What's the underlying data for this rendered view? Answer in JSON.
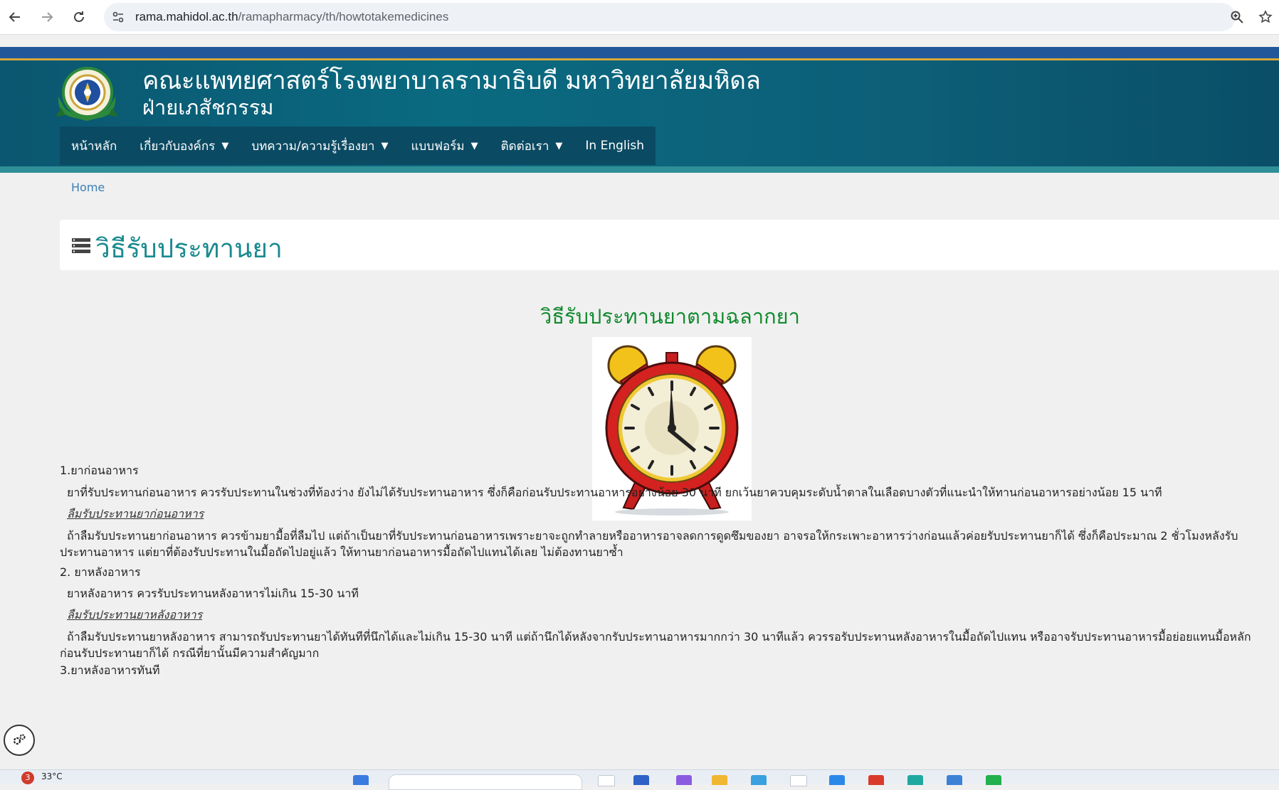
{
  "browser": {
    "url_host": "rama.mahidol.ac.th",
    "url_path": "/ramapharmacy/th/howtotakemedicines",
    "icons": [
      "back-arrow-icon",
      "forward-arrow-icon",
      "reload-icon",
      "site-info-icon",
      "zoom-icon",
      "bookmark-star-icon"
    ]
  },
  "header": {
    "title": "คณะแพทยศาสตร์โรงพยาบาลรามาธิบดี มหาวิทยาลัยมหิดล",
    "subtitle": "ฝ่ายเภสัชกรรม",
    "colors": {
      "primary": "#0b5670",
      "accent_gold": "#d8a83a",
      "top_strip": "#22589a",
      "teal_bar": "#2f8f98"
    }
  },
  "menu": {
    "items": [
      {
        "label": "หน้าหลัก",
        "has_dropdown": false
      },
      {
        "label": "เกี่ยวกับองค์กร",
        "has_dropdown": true
      },
      {
        "label": "บทความ/ความรู้เรื่องยา",
        "has_dropdown": true
      },
      {
        "label": "แบบฟอร์ม",
        "has_dropdown": true
      },
      {
        "label": "ติดต่อเรา",
        "has_dropdown": true
      },
      {
        "label": "In English",
        "has_dropdown": false
      }
    ],
    "caret": "▼"
  },
  "breadcrumb": {
    "home": "Home"
  },
  "page": {
    "title": "วิธีรับประทานยา",
    "subheading": "วิธีรับประทานยาตามฉลากยา",
    "title_color": "#1a8a8f",
    "subheading_color": "#118a2e"
  },
  "sections": {
    "s1_head": "1.ยาก่อนอาหาร",
    "s1_body": "ยาที่รับประทานก่อนอาหาร ควรรับประทานในช่วงที่ท้องว่าง ยังไม่ได้รับประทานอาหาร ซึ่งก็คือก่อนรับประทานอาหารอย่างน้อย 30 นาที ยกเว้นยาควบคุมระดับน้ำตาลในเลือดบางตัวที่แนะนำให้ทานก่อนอาหารอย่างน้อย 15 นาที",
    "s1_forgot_head": "ลืมรับประทานยาก่อนอาหาร",
    "s1_forgot_body": "ถ้าลืมรับประทานยาก่อนอาหาร ควรข้ามยามื้อที่ลืมไป แต่ถ้าเป็นยาที่รับประทานก่อนอาหารเพราะยาจะถูกทำลายหรืออาหารอาจลดการดูดซึมของยา อาจรอให้กระเพาะอาหารว่างก่อนแล้วค่อยรับประทานยาก็ได้ ซึ่งก็คือประมาณ 2 ชั่วโมงหลังรับประทานอาหาร แต่ยาที่ต้องรับประทานในมื้อถัดไปอยู่แล้ว ให้ทานยาก่อนอาหารมื้อถัดไปแทนได้เลย ไม่ต้องทานยาซ้ำ",
    "s2_head": "2. ยาหลังอาหาร",
    "s2_body": "ยาหลังอาหาร ควรรับประทานหลังอาหารไม่เกิน 15-30 นาที",
    "s2_forgot_head": "ลืมรับประทานยาหลังอาหาร",
    "s2_forgot_body": "ถ้าลืมรับประทานยาหลังอาหาร สามารถรับประทานยาได้ทันทีที่นึกได้และไม่เกิน 15-30 นาที แต่ถ้านึกได้หลังจากรับประทานอาหารมากกว่า 30 นาทีแล้ว ควรรอรับประทานหลังอาหารในมื้อถัดไปแทน หรืออาจรับประทานอาหารมื้อย่อยแทนมื้อหลักก่อนรับประทานยาก็ได้ กรณีที่ยานั้นมีความสำคัญมาก",
    "s3_head_partial": "3.ยาหลังอาหารทันที"
  },
  "taskbar": {
    "weather_badge": "3",
    "temperature": "33°C"
  }
}
